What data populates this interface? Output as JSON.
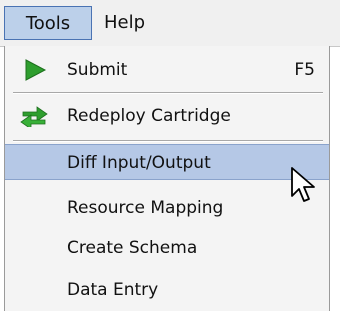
{
  "menubar": {
    "items": [
      {
        "label": "Tools",
        "active": true
      },
      {
        "label": "Help",
        "active": false
      }
    ]
  },
  "dropdown": {
    "items": [
      {
        "label": "Submit",
        "shortcut": "F5",
        "icon": "play-arrow-icon"
      },
      {
        "label": "Redeploy Cartridge",
        "icon": "redeploy-arrows-icon"
      },
      {
        "label": "Diff Input/Output",
        "highlighted": true
      },
      {
        "label": "Resource Mapping"
      },
      {
        "label": "Create Schema"
      },
      {
        "label": "Data Entry"
      }
    ]
  },
  "colors": {
    "highlight": "#b5c8e6",
    "icon_green": "#2e9e2e"
  }
}
